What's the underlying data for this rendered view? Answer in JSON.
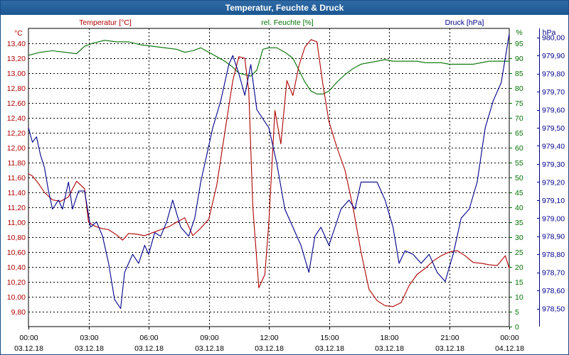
{
  "chart_data": {
    "type": "line",
    "title": "Temperatur, Feuchte & Druck",
    "x_ticks": [
      {
        "time": "00:00",
        "date": "03.12.18"
      },
      {
        "time": "03:00",
        "date": "03.12.18"
      },
      {
        "time": "06:00",
        "date": "03.12.18"
      },
      {
        "time": "09:00",
        "date": "03.12.18"
      },
      {
        "time": "12:00",
        "date": "03.12.18"
      },
      {
        "time": "15:00",
        "date": "03.12.18"
      },
      {
        "time": "18:00",
        "date": "03.12.18"
      },
      {
        "time": "21:00",
        "date": "03.12.18"
      },
      {
        "time": "00:00",
        "date": "04.12.18"
      }
    ],
    "x_range_hours": [
      0,
      24
    ],
    "grid": true,
    "axes": {
      "temperature": {
        "label": "Temperatur [°C]",
        "unit": "°C",
        "color": "#b00000",
        "range": [
          9.6,
          13.6
        ],
        "ticks": [
          "9,80",
          "10,00",
          "10,20",
          "10,40",
          "10,60",
          "10,80",
          "11,00",
          "11,20",
          "11,40",
          "11,60",
          "11,80",
          "12,00",
          "12,20",
          "12,40",
          "12,60",
          "12,80",
          "13,00",
          "13,20",
          "13,40"
        ]
      },
      "humidity": {
        "label": "rel. Feuchte [%]",
        "unit": "%",
        "color": "#007000",
        "range": [
          0,
          100
        ],
        "ticks": [
          "0",
          "5",
          "10",
          "15",
          "20",
          "25",
          "30",
          "35",
          "40",
          "45",
          "50",
          "55",
          "60",
          "65",
          "70",
          "75",
          "80",
          "85",
          "90",
          "95"
        ]
      },
      "pressure": {
        "label": "Druck [hPa]",
        "unit": "hPa",
        "color": "#00008b",
        "range": [
          978.4,
          980.05
        ],
        "ticks": [
          "978,50",
          "978,60",
          "978,70",
          "978,80",
          "978,90",
          "979,00",
          "979,10",
          "979,20",
          "979,30",
          "979,40",
          "979,50",
          "979,60",
          "979,70",
          "979,80",
          "979,90",
          "980,00"
        ]
      }
    },
    "series": [
      {
        "name": "Temperatur [°C]",
        "axis": "temperature",
        "color": "#b00000",
        "x": [
          0,
          0.2,
          0.5,
          0.8,
          1.2,
          1.6,
          2.0,
          2.4,
          2.8,
          3.0,
          3.3,
          3.6,
          4.0,
          4.4,
          4.7,
          5.0,
          5.4,
          5.8,
          6.2,
          6.6,
          7.0,
          7.4,
          7.8,
          8.2,
          8.6,
          9.0,
          9.4,
          9.8,
          10.2,
          10.5,
          10.8,
          11.0,
          11.2,
          11.5,
          11.8,
          12.0,
          12.3,
          12.6,
          12.9,
          13.2,
          13.5,
          13.8,
          14.1,
          14.4,
          14.7,
          15.0,
          15.4,
          15.8,
          16.2,
          16.6,
          17.0,
          17.4,
          17.8,
          18.2,
          18.6,
          19.0,
          19.4,
          19.8,
          20.2,
          20.6,
          21.0,
          21.4,
          21.8,
          22.2,
          22.6,
          23.0,
          23.4,
          23.8,
          24.0
        ],
        "y": [
          11.65,
          11.62,
          11.52,
          11.4,
          11.3,
          11.28,
          11.34,
          11.55,
          11.45,
          11.0,
          10.95,
          10.92,
          10.9,
          10.83,
          10.76,
          10.85,
          10.84,
          10.82,
          10.86,
          10.9,
          10.94,
          11.0,
          11.06,
          10.82,
          10.92,
          11.04,
          11.5,
          12.2,
          12.9,
          13.22,
          13.2,
          12.75,
          11.2,
          10.12,
          10.3,
          11.0,
          12.5,
          12.05,
          12.9,
          12.7,
          13.1,
          13.35,
          13.45,
          13.42,
          12.85,
          12.35,
          12.0,
          11.7,
          11.2,
          10.6,
          10.1,
          9.95,
          9.88,
          9.87,
          9.92,
          10.15,
          10.3,
          10.38,
          10.48,
          10.55,
          10.6,
          10.62,
          10.55,
          10.46,
          10.45,
          10.43,
          10.42,
          10.55,
          10.38
        ]
      },
      {
        "name": "rel. Feuchte [%]",
        "axis": "humidity",
        "color": "#007000",
        "x": [
          0,
          0.6,
          1.2,
          1.8,
          2.4,
          2.8,
          3.2,
          3.8,
          4.4,
          5.0,
          5.6,
          6.2,
          6.8,
          7.4,
          7.8,
          8.2,
          8.6,
          9.0,
          9.4,
          9.8,
          10.2,
          10.5,
          10.8,
          11.1,
          11.4,
          11.7,
          12.0,
          12.4,
          12.8,
          13.2,
          13.5,
          13.8,
          14.1,
          14.4,
          14.7,
          15.0,
          15.4,
          15.8,
          16.2,
          16.6,
          17.0,
          17.4,
          17.8,
          18.2,
          18.6,
          19.0,
          19.4,
          19.8,
          20.2,
          20.6,
          21.0,
          21.4,
          21.8,
          22.2,
          22.6,
          23.0,
          23.4,
          23.8,
          24.0
        ],
        "y": [
          91,
          92,
          92.5,
          92,
          91.5,
          94,
          95,
          96,
          95.5,
          95.5,
          94.5,
          94,
          93.5,
          93,
          92,
          92.5,
          93.5,
          92,
          90.5,
          89,
          87,
          85,
          84.5,
          84,
          86,
          93,
          93.5,
          93.5,
          92,
          90,
          86,
          82,
          79,
          78,
          78,
          79,
          82,
          84.5,
          86.5,
          88,
          88.5,
          89,
          89.5,
          89,
          89,
          89,
          89,
          88.5,
          88.5,
          88.5,
          88,
          88,
          88,
          88,
          88.5,
          89,
          89,
          89,
          89
        ]
      },
      {
        "name": "Druck [hPa]",
        "axis": "pressure",
        "color": "#00008b",
        "x": [
          0,
          0.2,
          0.4,
          0.6,
          0.8,
          1.0,
          1.2,
          1.5,
          1.7,
          2.0,
          2.2,
          2.5,
          2.8,
          3.1,
          3.4,
          3.7,
          4.0,
          4.3,
          4.6,
          4.8,
          5.0,
          5.2,
          5.5,
          5.8,
          6.0,
          6.3,
          6.6,
          6.9,
          7.2,
          7.6,
          8.0,
          8.3,
          8.6,
          8.9,
          9.2,
          9.6,
          10.0,
          10.2,
          10.5,
          10.8,
          11.1,
          11.4,
          11.7,
          12.0,
          12.4,
          12.8,
          13.2,
          13.6,
          14.0,
          14.3,
          14.6,
          15.0,
          15.3,
          15.6,
          16.0,
          16.3,
          16.6,
          17.0,
          17.4,
          17.8,
          18.2,
          18.5,
          18.8,
          19.2,
          19.6,
          20.0,
          20.4,
          20.8,
          21.2,
          21.6,
          22.0,
          22.4,
          22.8,
          23.2,
          23.6,
          24.0
        ],
        "y": [
          979.5,
          979.42,
          979.45,
          979.35,
          979.28,
          979.15,
          979.05,
          979.1,
          979.05,
          979.2,
          979.05,
          979.15,
          979.15,
          978.95,
          978.98,
          978.9,
          978.75,
          978.55,
          978.5,
          978.7,
          978.75,
          978.8,
          978.75,
          978.85,
          978.8,
          978.92,
          978.9,
          978.98,
          979.1,
          978.95,
          978.9,
          979.0,
          979.2,
          979.35,
          979.5,
          979.65,
          979.85,
          979.9,
          979.8,
          979.68,
          979.85,
          979.6,
          979.55,
          979.5,
          979.3,
          979.05,
          978.95,
          978.85,
          978.7,
          978.9,
          978.95,
          978.85,
          978.95,
          979.05,
          979.1,
          979.05,
          979.2,
          979.2,
          979.2,
          979.1,
          978.95,
          978.75,
          978.82,
          978.8,
          978.75,
          978.8,
          978.7,
          978.65,
          978.8,
          979.0,
          979.05,
          979.2,
          979.5,
          979.65,
          979.75,
          980.02
        ]
      }
    ]
  }
}
